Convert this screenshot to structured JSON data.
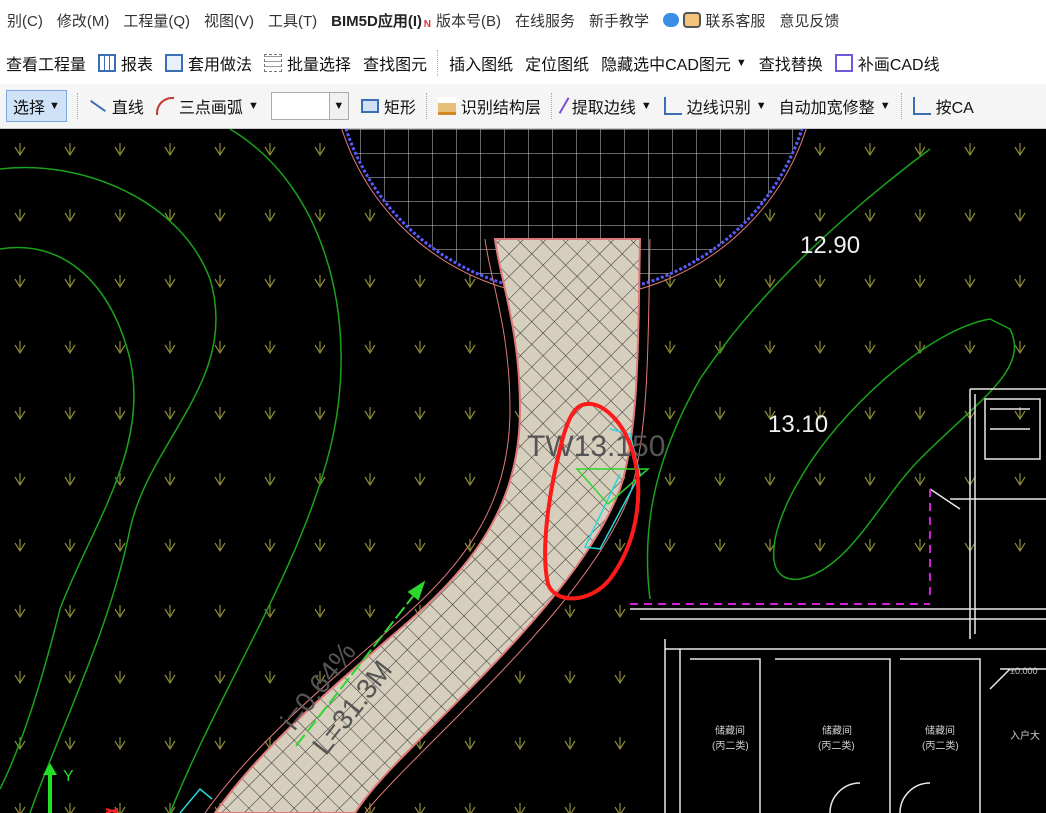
{
  "menu": {
    "items": [
      "别(C)",
      "修改(M)",
      "工程量(Q)",
      "视图(V)",
      "工具(T)",
      "BIM5D应用(I)",
      "版本号(B)",
      "在线服务",
      "新手教学",
      "联系客服",
      "意见反馈"
    ],
    "new_badge": "N"
  },
  "toolbar1": {
    "items": [
      "查看工程量",
      "报表",
      "套用做法",
      "批量选择",
      "查找图元",
      "插入图纸",
      "定位图纸",
      "隐藏选中CAD图元",
      "查找替换",
      "补画CAD线"
    ]
  },
  "toolbar2": {
    "select_label": "选择",
    "line_label": "直线",
    "arc_label": "三点画弧",
    "combo_value": "",
    "rect_label": "矩形",
    "layer_label": "识别结构层",
    "extract_label": "提取边线",
    "edge_label": "边线识别",
    "auto_label": "自动加宽修整",
    "by_label": "按CA"
  },
  "drawing": {
    "labels": [
      "12.90",
      "13.10",
      "TW13.150",
      "i=0.64%",
      "L=31.3M"
    ],
    "axis_y": "Y",
    "room_label": "储藏间",
    "room_sub": "(丙二类)",
    "entrance_label": "入户大",
    "elevation_mark": "±0.000",
    "colors": {
      "contour": "#1aa31a",
      "road_fill": "#d6cfbd",
      "road_edge": "#e07a7a",
      "annotation": "#ff1a1a",
      "building": "#e8e8e8",
      "magenta": "#d020d0",
      "cyan": "#27d7e0",
      "tree_symbol": "#8a8a3a"
    }
  }
}
